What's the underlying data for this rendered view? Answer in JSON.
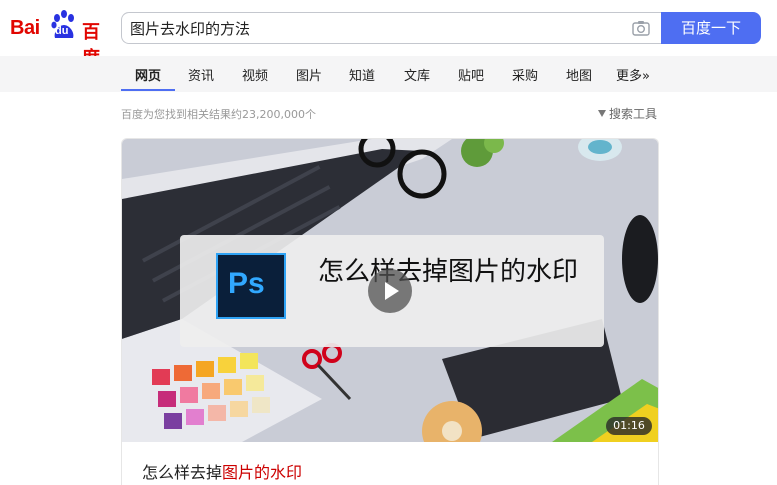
{
  "brand": {
    "logo_latin": "Bai",
    "logo_du": "du",
    "logo_cn": "百度",
    "color": "#e10601"
  },
  "search": {
    "query": "图片去水印的方法",
    "button_label": "百度一下",
    "accent": "#4e6ef2",
    "camera_icon": "camera-icon"
  },
  "tabs": [
    {
      "label": "网页",
      "active": true
    },
    {
      "label": "资讯"
    },
    {
      "label": "视频"
    },
    {
      "label": "图片"
    },
    {
      "label": "知道"
    },
    {
      "label": "文库"
    },
    {
      "label": "贴吧"
    },
    {
      "label": "采购"
    },
    {
      "label": "地图"
    },
    {
      "label": "更多»"
    }
  ],
  "results": {
    "stat_text": "百度为您找到相关结果约23,200,000个",
    "tools_label": "搜索工具",
    "tools_icon": "funnel-icon"
  },
  "video_card": {
    "overlay_title": "怎么样去掉图片的水印",
    "ps_label": "Ps",
    "duration": "01:16",
    "title_prefix": "怎么样去掉",
    "title_highlight": "图片的水印",
    "highlight_color": "#cc0000"
  }
}
